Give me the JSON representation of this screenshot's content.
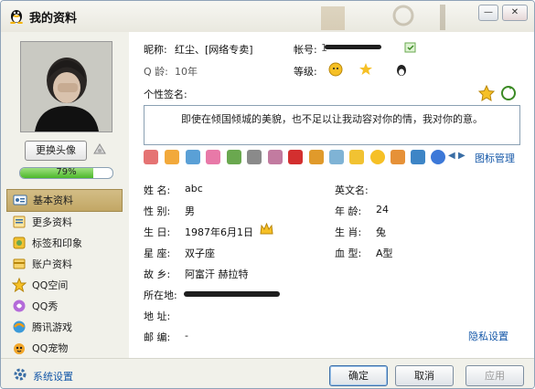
{
  "window": {
    "title": "我的资料",
    "minimize_glyph": "—",
    "close_glyph": "✕"
  },
  "sidebar": {
    "change_avatar_label": "更换头像",
    "progress_value": 0.79,
    "progress_label": "79%",
    "items": [
      {
        "label": "基本资料",
        "icon": "id-card-icon"
      },
      {
        "label": "更多资料",
        "icon": "document-icon"
      },
      {
        "label": "标签和印象",
        "icon": "tag-icon"
      },
      {
        "label": "账户资料",
        "icon": "account-icon"
      },
      {
        "label": "QQ空间",
        "icon": "star-icon"
      },
      {
        "label": "QQ秀",
        "icon": "qqshow-icon"
      },
      {
        "label": "腾讯游戏",
        "icon": "game-icon"
      },
      {
        "label": "QQ宠物",
        "icon": "pet-icon"
      }
    ]
  },
  "profile": {
    "nickname_label": "昵称:",
    "nickname_value": "红尘、[网络专卖]",
    "account_label": "帐号:",
    "account_value": "1",
    "qage_label": "Q 龄:",
    "qage_value": "10年",
    "level_label": "等级:",
    "signature_label": "个性签名:",
    "signature_text": "即使在倾国倾城的美貌，也不足以让我动容对你的情，我对你的意。",
    "icon_manage_label": "图标管理"
  },
  "basic": {
    "name_label": "姓    名:",
    "name_value": "abc",
    "english_label": "英文名:",
    "gender_label": "性    别:",
    "gender_value": "男",
    "age_label": "年    龄:",
    "age_value": "24",
    "birthday_label": "生    日:",
    "birthday_value": "1987年6月1日",
    "zodiac_label": "生    肖:",
    "zodiac_value": "兔",
    "constellation_label": "星    座:",
    "constellation_value": "双子座",
    "blood_label": "血    型:",
    "blood_value": "A型",
    "hometown_label": "故    乡:",
    "hometown_value": "阿富汗  赫拉特",
    "location_label": "所在地:",
    "address_label": "地    址:",
    "postcode_label": "邮    编:",
    "postcode_value": "-",
    "privacy_link": "隐私设置"
  },
  "footer": {
    "settings_label": "系统设置",
    "ok_label": "确定",
    "cancel_label": "取消",
    "apply_label": "应用"
  },
  "colors": {
    "accent_blue": "#1457a8",
    "nav_active": "#c9b06f",
    "progress_green": "#4cb82a"
  }
}
